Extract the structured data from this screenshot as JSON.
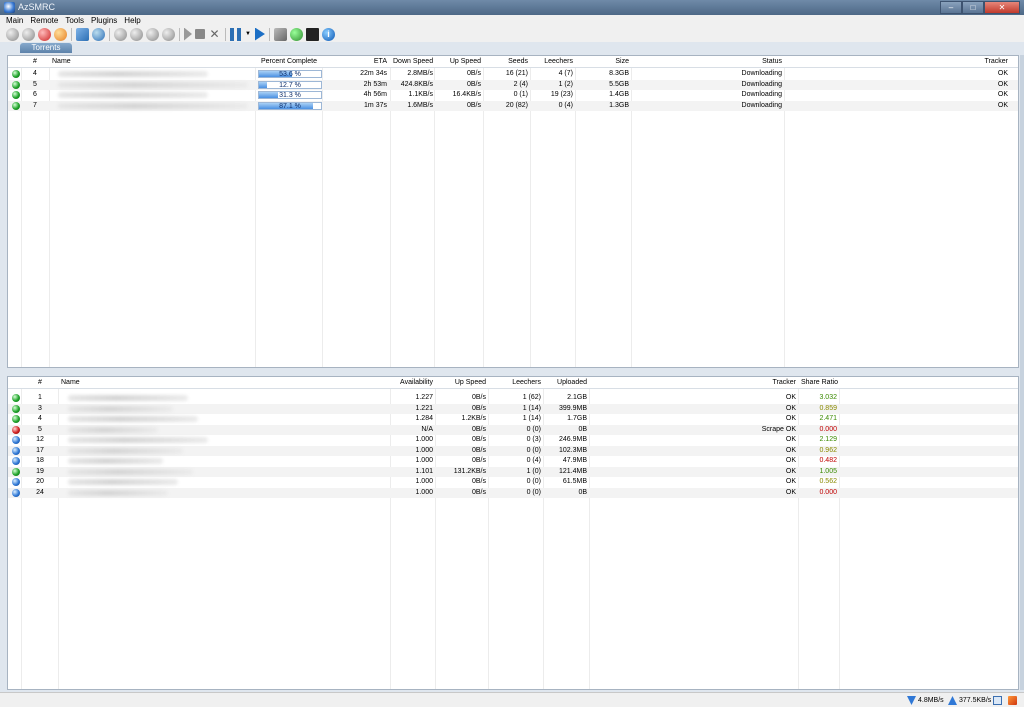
{
  "window": {
    "title": "AzSMRC",
    "min": "–",
    "max": "□",
    "close": "✕"
  },
  "menu": [
    "Main",
    "Remote",
    "Tools",
    "Plugins",
    "Help"
  ],
  "toolbar": {
    "info_glyph": "i",
    "x_glyph": "✕",
    "dropdown_glyph": "▼"
  },
  "tabs": [
    {
      "label": "Torrents"
    }
  ],
  "torrents": {
    "columns": {
      "num": "#",
      "name": "Name",
      "percent": "Percent Complete",
      "eta": "ETA",
      "down": "Down Speed",
      "up": "Up Speed",
      "seeds": "Seeds",
      "leechers": "Leechers",
      "size": "Size",
      "status": "Status",
      "tracker": "Tracker"
    },
    "rows": [
      {
        "num": "4",
        "percent": 53.6,
        "percent_text": "53.6 %",
        "eta": "22m 34s",
        "down": "2.8MB/s",
        "up": "0B/s",
        "seeds": "16 (21)",
        "leechers": "4 (7)",
        "size": "8.3GB",
        "status": "Downloading",
        "tracker": "OK",
        "icon": "green"
      },
      {
        "num": "5",
        "percent": 12.7,
        "percent_text": "12.7 %",
        "eta": "2h 53m",
        "down": "424.8KB/s",
        "up": "0B/s",
        "seeds": "2 (4)",
        "leechers": "1 (2)",
        "size": "5.5GB",
        "status": "Downloading",
        "tracker": "OK",
        "icon": "green"
      },
      {
        "num": "6",
        "percent": 31.3,
        "percent_text": "31.3 %",
        "eta": "4h 56m",
        "down": "1.1KB/s",
        "up": "16.4KB/s",
        "seeds": "0 (1)",
        "leechers": "19 (23)",
        "size": "1.4GB",
        "status": "Downloading",
        "tracker": "OK",
        "icon": "green"
      },
      {
        "num": "7",
        "percent": 87.1,
        "percent_text": "87.1 %",
        "eta": "1m 37s",
        "down": "1.6MB/s",
        "up": "0B/s",
        "seeds": "20 (82)",
        "leechers": "0 (4)",
        "size": "1.3GB",
        "status": "Downloading",
        "tracker": "OK",
        "icon": "green"
      }
    ]
  },
  "files": {
    "columns": {
      "num": "#",
      "name": "Name",
      "availability": "Availability",
      "up": "Up Speed",
      "leechers": "Leechers",
      "uploaded": "Uploaded",
      "tracker": "Tracker",
      "ratio": "Share Ratio"
    },
    "rows": [
      {
        "num": "1",
        "availability": "1.227",
        "up": "0B/s",
        "leechers": "1 (62)",
        "uploaded": "2.1GB",
        "tracker": "OK",
        "ratio": "3.032",
        "ratio_color": "green",
        "icon": "green"
      },
      {
        "num": "3",
        "availability": "1.221",
        "up": "0B/s",
        "leechers": "1 (14)",
        "uploaded": "399.9MB",
        "tracker": "OK",
        "ratio": "0.859",
        "ratio_color": "olive",
        "icon": "green"
      },
      {
        "num": "4",
        "availability": "1.284",
        "up": "1.2KB/s",
        "leechers": "1 (14)",
        "uploaded": "1.7GB",
        "tracker": "OK",
        "ratio": "2.471",
        "ratio_color": "green",
        "icon": "green"
      },
      {
        "num": "5",
        "availability": "N/A",
        "up": "0B/s",
        "leechers": "0 (0)",
        "uploaded": "0B",
        "tracker": "Scrape OK",
        "ratio": "0.000",
        "ratio_color": "red",
        "icon": "red"
      },
      {
        "num": "12",
        "availability": "1.000",
        "up": "0B/s",
        "leechers": "0 (3)",
        "uploaded": "246.9MB",
        "tracker": "OK",
        "ratio": "2.129",
        "ratio_color": "green",
        "icon": "blue"
      },
      {
        "num": "17",
        "availability": "1.000",
        "up": "0B/s",
        "leechers": "0 (0)",
        "uploaded": "102.3MB",
        "tracker": "OK",
        "ratio": "0.962",
        "ratio_color": "olive",
        "icon": "blue"
      },
      {
        "num": "18",
        "availability": "1.000",
        "up": "0B/s",
        "leechers": "0 (4)",
        "uploaded": "47.9MB",
        "tracker": "OK",
        "ratio": "0.482",
        "ratio_color": "red",
        "icon": "blue"
      },
      {
        "num": "19",
        "availability": "1.101",
        "up": "131.2KB/s",
        "leechers": "1 (0)",
        "uploaded": "121.4MB",
        "tracker": "OK",
        "ratio": "1.005",
        "ratio_color": "green",
        "icon": "green"
      },
      {
        "num": "20",
        "availability": "1.000",
        "up": "0B/s",
        "leechers": "0 (0)",
        "uploaded": "61.5MB",
        "tracker": "OK",
        "ratio": "0.562",
        "ratio_color": "olive",
        "icon": "blue"
      },
      {
        "num": "24",
        "availability": "1.000",
        "up": "0B/s",
        "leechers": "0 (0)",
        "uploaded": "0B",
        "tracker": "OK",
        "ratio": "0.000",
        "ratio_color": "red",
        "icon": "blue"
      }
    ]
  },
  "scrollbar": {
    "grip": "|||"
  },
  "status": {
    "down_speed": "4.8MB/s",
    "up_speed": "377.5KB/s"
  }
}
